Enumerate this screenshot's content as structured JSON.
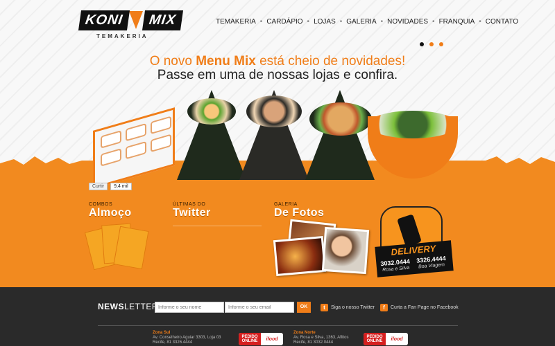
{
  "logo": {
    "name_left": "KONI",
    "name_right": "MIX",
    "subtitle": "TEMAKERIA"
  },
  "nav": {
    "items": [
      "TEMAKERIA",
      "CARDÁPIO",
      "LOJAS",
      "GALERIA",
      "NOVIDADES",
      "FRANQUIA",
      "CONTATO"
    ],
    "separator": "•"
  },
  "hero": {
    "line1_prefix": "O novo ",
    "line1_highlight": "Menu Mix",
    "line1_suffix": " está cheio de novidades!",
    "line2": "Passe em uma de nossas lojas e confira."
  },
  "facebook_like": {
    "button_label": "Curtir",
    "count": "9,4 mil"
  },
  "sections": {
    "combos": {
      "small": "Combos",
      "big": "Almoço"
    },
    "twitter": {
      "small": "Últimas do",
      "big": "Twitter"
    },
    "galeria": {
      "small": "Galeria",
      "big": "De Fotos"
    }
  },
  "delivery": {
    "title": "DELIVERY",
    "phone1": "3032.0444",
    "location1": "Rosa e Silva",
    "phone2": "3326.4444",
    "location2": "Boa Viagem"
  },
  "newsletter": {
    "label_bold": "NEWS",
    "label_rest": "LETTER",
    "name_placeholder": "Informe o seu nome",
    "email_placeholder": "Informe o seu email",
    "submit_label": "OK"
  },
  "social": {
    "twitter_label": "Siga o nosso Twitter",
    "facebook_label": "Curta a Fan Page no Facebook"
  },
  "stores": [
    {
      "zone": "Zona Sul",
      "address": "Av. Conselheiro Aguiar 3303, Loja 03",
      "phone": "Recife, 81 3326.4444"
    },
    {
      "zone": "Zona Norte",
      "address": "Av. Rosa e Silva, 1363, Aflitos",
      "phone": "Recife, 81 3032.0444"
    }
  ],
  "order_badge": {
    "line1": "PEDIDO",
    "line2": "ONLINE",
    "brand": "ifood"
  },
  "colors": {
    "accent": "#f07d18",
    "band": "#f28a1f",
    "footer": "#2a2a2a"
  }
}
